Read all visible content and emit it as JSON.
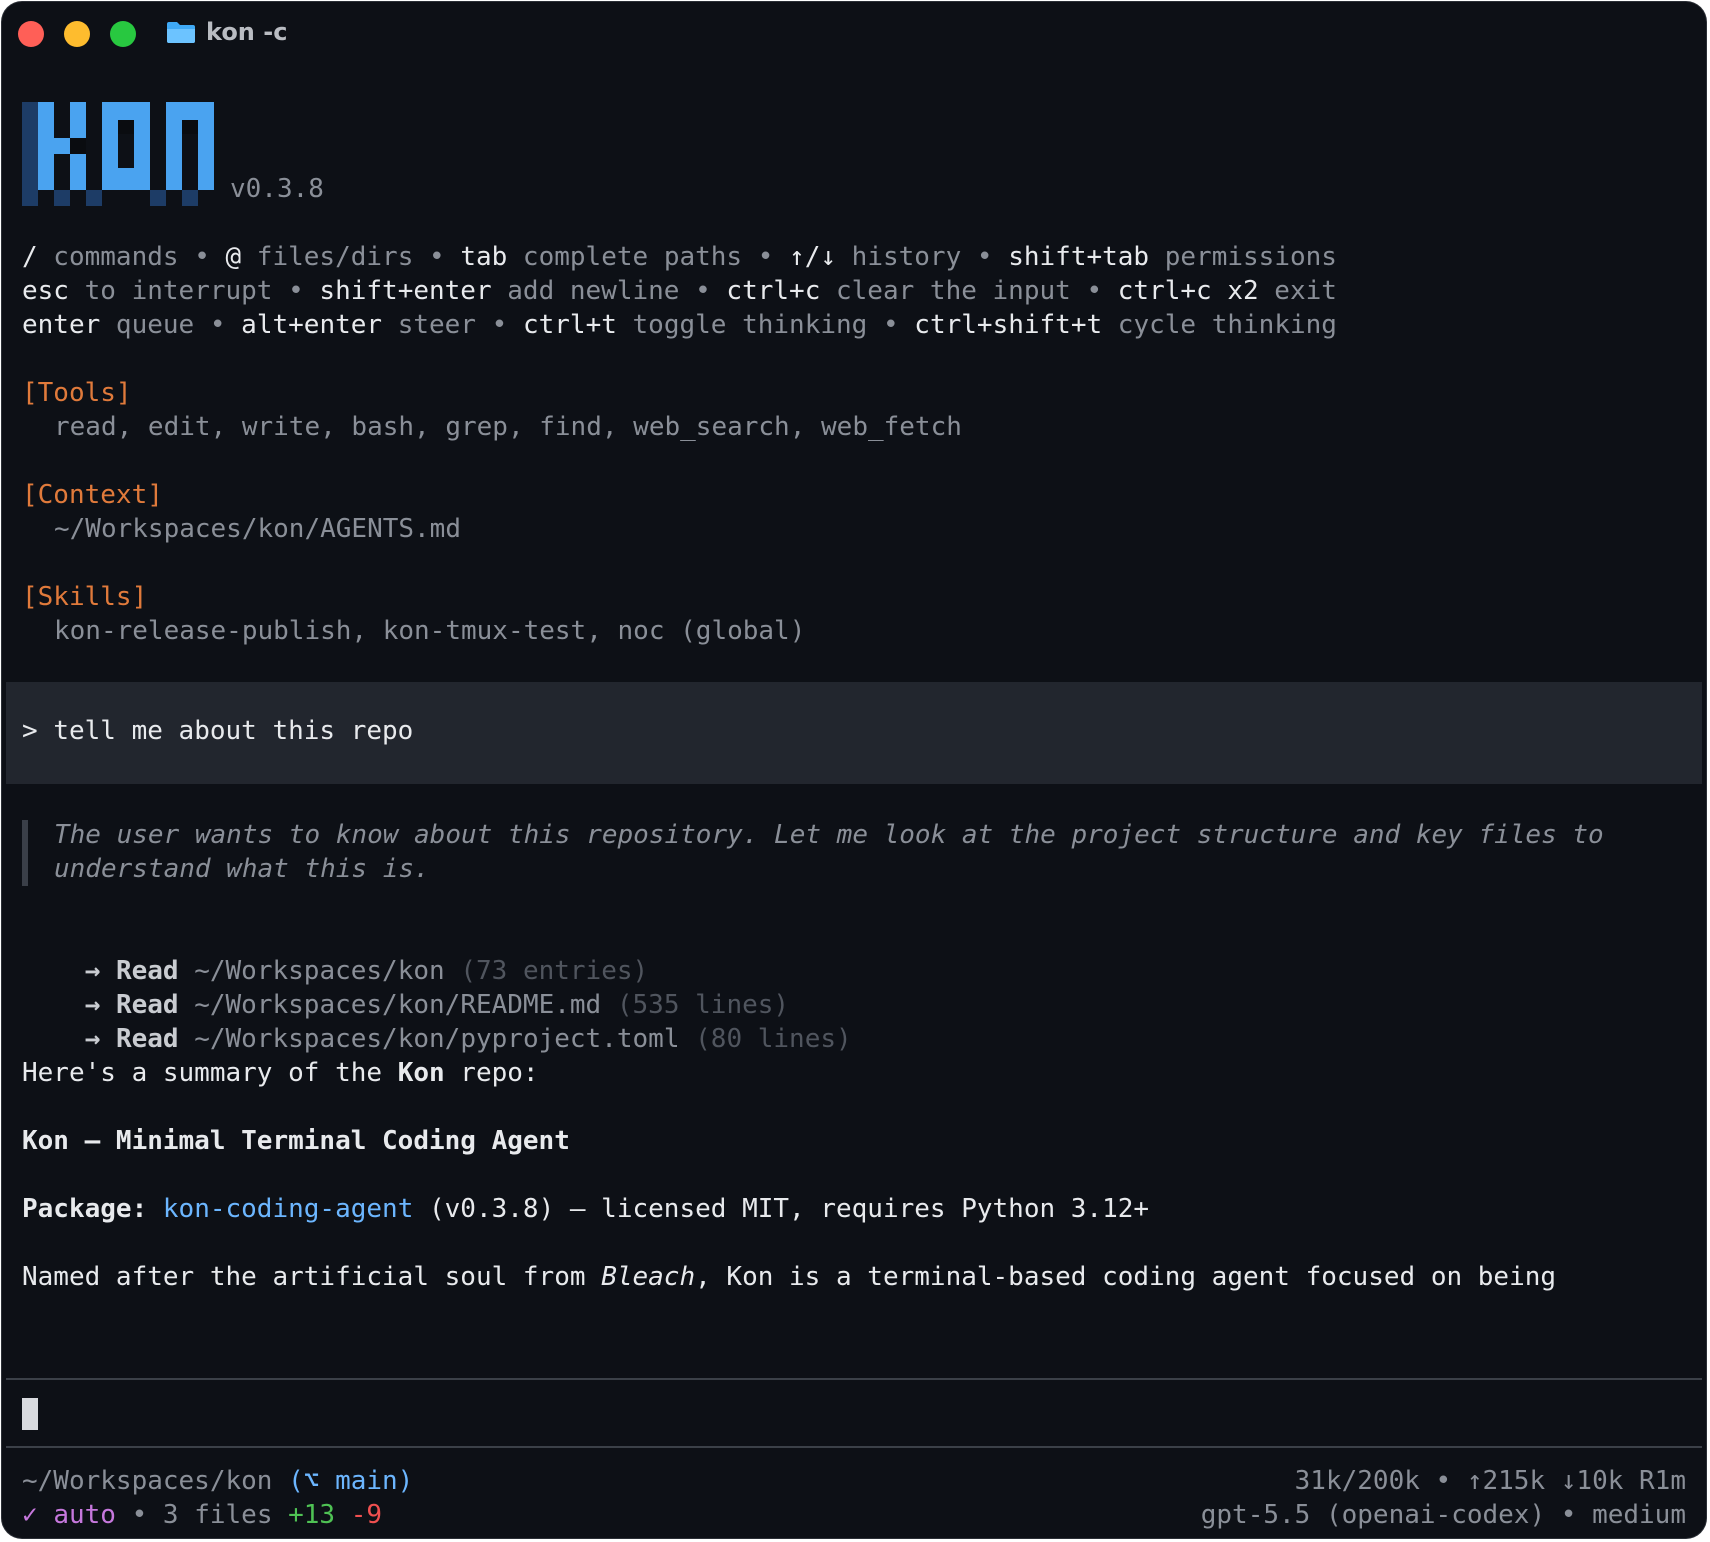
{
  "window": {
    "title": "kon -c"
  },
  "logo": {
    "text": "KON",
    "version": "v0.3.8"
  },
  "help": {
    "line1": [
      {
        "text": "/",
        "bright": true
      },
      {
        "text": " commands • ",
        "bright": false
      },
      {
        "text": "@",
        "bright": true
      },
      {
        "text": " files/dirs • ",
        "bright": false
      },
      {
        "text": "tab",
        "bright": true
      },
      {
        "text": " complete paths • ",
        "bright": false
      },
      {
        "text": "↑/↓",
        "bright": true
      },
      {
        "text": " history • ",
        "bright": false
      },
      {
        "text": "shift+tab",
        "bright": true
      },
      {
        "text": " permissions",
        "bright": false
      }
    ],
    "line2": [
      {
        "text": "esc",
        "bright": true
      },
      {
        "text": " to interrupt • ",
        "bright": false
      },
      {
        "text": "shift+enter",
        "bright": true
      },
      {
        "text": " add newline • ",
        "bright": false
      },
      {
        "text": "ctrl+c",
        "bright": true
      },
      {
        "text": " clear the input • ",
        "bright": false
      },
      {
        "text": "ctrl+c x2",
        "bright": true
      },
      {
        "text": " exit",
        "bright": false
      }
    ],
    "line3": [
      {
        "text": "enter",
        "bright": true
      },
      {
        "text": " queue • ",
        "bright": false
      },
      {
        "text": "alt+enter",
        "bright": true
      },
      {
        "text": " steer • ",
        "bright": false
      },
      {
        "text": "ctrl+t",
        "bright": true
      },
      {
        "text": " toggle thinking • ",
        "bright": false
      },
      {
        "text": "ctrl+shift+t",
        "bright": true
      },
      {
        "text": " cycle thinking",
        "bright": false
      }
    ]
  },
  "sections": {
    "tools": {
      "title": "[Tools]",
      "value": "read, edit, write, bash, grep, find, web_search, web_fetch"
    },
    "context": {
      "title": "[Context]",
      "value": "~/Workspaces/kon/AGENTS.md"
    },
    "skills": {
      "title": "[Skills]",
      "value": "kon-release-publish, kon-tmux-test, noc (global)"
    }
  },
  "prompt": {
    "marker": ">",
    "text": "tell me about this repo"
  },
  "thinking": {
    "line1": "The user wants to know about this repository. Let me look at the project structure and key files to",
    "line2": "understand what this is."
  },
  "reads": [
    {
      "arrow": "→",
      "label": "Read",
      "path": "~/Workspaces/kon",
      "meta": "(73 entries)"
    },
    {
      "arrow": "→",
      "label": "Read",
      "path": "~/Workspaces/kon/README.md",
      "meta": "(535 lines)"
    },
    {
      "arrow": "→",
      "label": "Read",
      "path": "~/Workspaces/kon/pyproject.toml",
      "meta": "(80 lines)"
    }
  ],
  "summary": {
    "intro_pre": "Here's a summary of the ",
    "intro_bold": "Kon",
    "intro_post": " repo:",
    "heading": "Kon — Minimal Terminal Coding Agent",
    "package_label": "Package:",
    "package_name": "kon-coding-agent",
    "package_rest": " (v0.3.8) — licensed MIT, requires Python 3.12+",
    "named_pre": "Named after the artificial soul from ",
    "named_italic": "Bleach",
    "named_post": ", Kon is a terminal-based coding agent focused on being"
  },
  "status": {
    "cwd": "~/Workspaces/kon",
    "branch": "(⌥ main)",
    "check": "✓",
    "mode": "auto",
    "files": " • 3 files ",
    "added": "+13",
    "removed": "-9",
    "tokens": "31k/200k • ↑215k ↓10k R1m",
    "model": "gpt-5.5 (openai-codex) • medium"
  },
  "colors": {
    "background": "#0d1016",
    "accent_orange": "#e07a3b",
    "link_blue": "#6cb6ff",
    "logo_blue": "#4aa3f0"
  }
}
